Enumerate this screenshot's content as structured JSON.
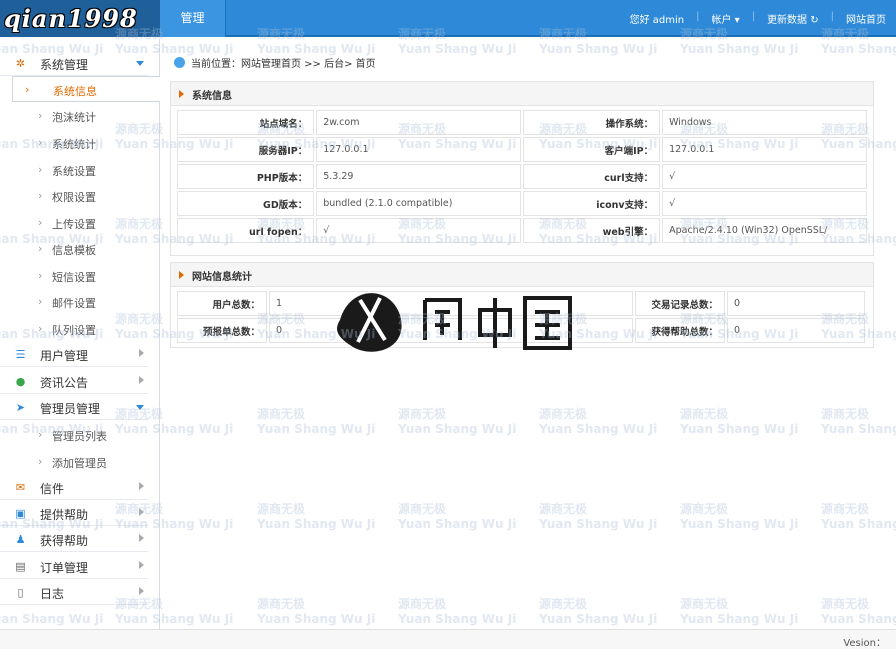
{
  "header": {
    "logo": "qian1998",
    "tab": "管理",
    "greeting": "您好 admin",
    "account": "帐户",
    "refresh": "更新数据",
    "site_home": "网站首页"
  },
  "sidebar": {
    "groups": [
      {
        "label": "系统管理",
        "icon": "gear-icon"
      },
      {
        "label": "用户管理",
        "icon": "list-icon"
      },
      {
        "label": "资讯公告",
        "icon": "location-icon"
      },
      {
        "label": "管理员管理",
        "icon": "send-icon"
      },
      {
        "label": "信件",
        "icon": "chat-icon"
      },
      {
        "label": "提供帮助",
        "icon": "image-icon"
      },
      {
        "label": "获得帮助",
        "icon": "user-icon"
      },
      {
        "label": "订单管理",
        "icon": "document-icon"
      },
      {
        "label": "日志",
        "icon": "file-icon"
      }
    ],
    "system_items": [
      "系统信息",
      "泡沫统计",
      "系统统计",
      "系统设置",
      "权限设置",
      "上传设置",
      "信息模板",
      "短信设置",
      "邮件设置",
      "队列设置"
    ],
    "admin_items": [
      "管理员列表",
      "添加管理员"
    ]
  },
  "breadcrumb": "当前位置：网站管理首页 >> 后台> 首页",
  "system_info": {
    "title": "系统信息",
    "rows": [
      {
        "k1": "站点域名：",
        "v1": "2w.com",
        "k2": "操作系统：",
        "v2": "Windows"
      },
      {
        "k1": "服务器IP：",
        "v1": "127.0.0.1",
        "k2": "客户端IP：",
        "v2": "127.0.0.1"
      },
      {
        "k1": "PHP版本：",
        "v1": "5.3.29",
        "k2": "curl支持：",
        "v2": "√"
      },
      {
        "k1": "GD版本：",
        "v1": "bundled (2.1.0 compatible)",
        "k2": "iconv支持：",
        "v2": "√"
      },
      {
        "k1": "url fopen：",
        "v1": "√",
        "k2": "web引擎：",
        "v2": "Apache/2.4.10 (Win32) OpenSSL/"
      }
    ]
  },
  "site_stats": {
    "title": "网站信息统计",
    "rows": [
      {
        "k1": "用户总数：",
        "v1": "1",
        "k2": "交易记录总数：",
        "v2": "0"
      },
      {
        "k1": "预报单总数：",
        "v1": "0",
        "k2": "获得帮助总数：",
        "v2": "0"
      }
    ]
  },
  "footer": {
    "version": "Vesion："
  },
  "watermark": {
    "cn": "源商无极",
    "en": "Yuan Shang Wu Ji"
  },
  "colors": {
    "header": "#2e8ad8",
    "active": "#e06a00"
  }
}
